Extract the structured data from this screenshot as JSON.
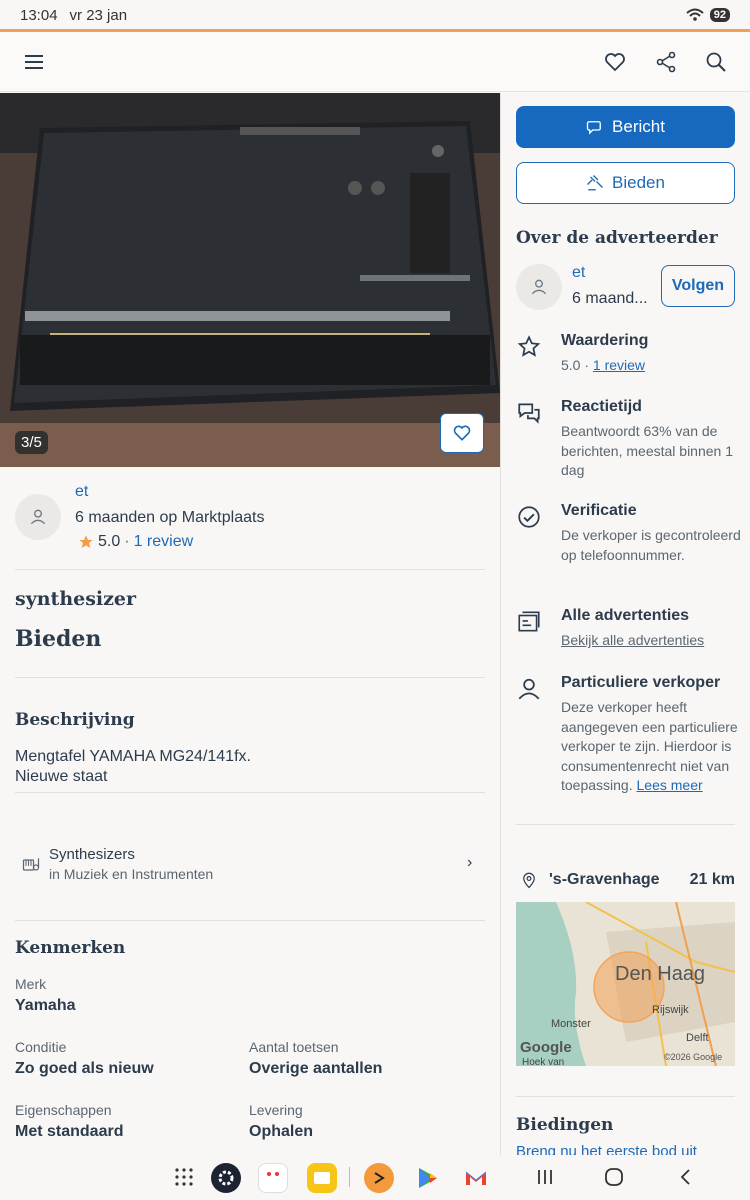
{
  "status": {
    "time": "13:04",
    "date": "vr 23 jan",
    "battery": "92"
  },
  "nav": {
    "menu_icon": "hamburger-icon",
    "favorite_icon": "heart-icon",
    "share_icon": "share-icon",
    "search_icon": "search-icon"
  },
  "photo": {
    "counter": "3/5",
    "fav_icon": "heart-icon"
  },
  "seller_short": {
    "name": "et",
    "since": "6 maanden op Marktplaats",
    "rating": "5.0",
    "review_link": "1 review"
  },
  "listing": {
    "title": "synthesizer",
    "price": "Bieden"
  },
  "description": {
    "heading": "Beschrijving",
    "line1": "Mengtafel YAMAHA MG24/141fx.",
    "line2": "Nieuwe staat"
  },
  "category": {
    "name": "Synthesizers",
    "parent": "in Muziek en Instrumenten"
  },
  "features": {
    "heading": "Kenmerken",
    "items": [
      {
        "label": "Merk",
        "value": "Yamaha"
      },
      {
        "label": "Conditie",
        "value": "Zo goed als nieuw"
      },
      {
        "label": "Aantal toetsen",
        "value": "Overige aantallen"
      },
      {
        "label": "Eigenschappen",
        "value": "Met standaard"
      },
      {
        "label": "Levering",
        "value": "Ophalen"
      }
    ]
  },
  "actions": {
    "message": "Bericht",
    "bid": "Bieden"
  },
  "advertiser": {
    "heading": "Over de adverteerder",
    "name": "et",
    "since": "6 maand...",
    "follow": "Volgen",
    "rating_title": "Waardering",
    "rating_value": "5.0 · ",
    "rating_link": "1 review",
    "response_title": "Reactietijd",
    "response_text": "Beantwoordt 63% van de berichten, meestal binnen 1 dag",
    "verify_title": "Verificatie",
    "verify_text": "De verkoper is gecontroleerd op telefoonnummer.",
    "all_title": "Alle advertenties",
    "all_link": "Bekijk alle advertenties",
    "private_title": "Particuliere verkoper",
    "private_text": "Deze verkoper heeft aangegeven een particuliere verkoper te zijn. Hierdoor is consumentenrecht niet van toepassing. ",
    "private_link": "Lees meer"
  },
  "location": {
    "city": "'s-Gravenhage",
    "distance": "21 km",
    "map_city": "Den Haag",
    "map_places": [
      "Monster",
      "Rijswijk",
      "Delft",
      "Hoek van"
    ],
    "map_brand": "Google",
    "map_copyright": "©2026 Google"
  },
  "bids": {
    "heading": "Biedingen",
    "cta": "Breng nu het eerste bod uit"
  }
}
